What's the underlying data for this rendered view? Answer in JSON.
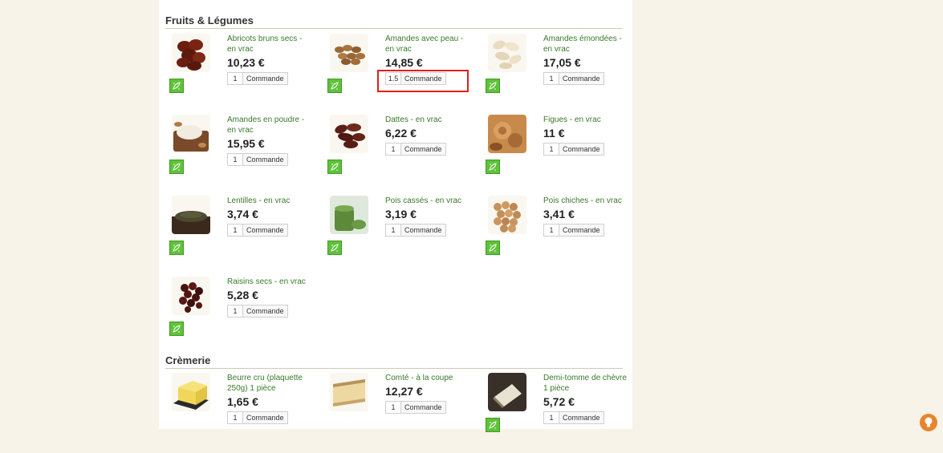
{
  "sections": [
    {
      "title": "Fruits & Légumes",
      "products": [
        {
          "name": "Abricots bruns secs - en vrac",
          "price": "10,23 €",
          "qty": "1",
          "button": "Commande",
          "bio": true
        },
        {
          "name": "Amandes avec peau - en vrac",
          "price": "14,85 €",
          "qty": "1.5",
          "button": "Commande",
          "bio": true
        },
        {
          "name": "Amandes émondées - en vrac",
          "price": "17,05 €",
          "qty": "1",
          "button": "Commande",
          "bio": true
        },
        {
          "name": "Amandes en poudre - en vrac",
          "price": "15,95 €",
          "qty": "1",
          "button": "Commande",
          "bio": true
        },
        {
          "name": "Dattes - en vrac",
          "price": "6,22 €",
          "qty": "1",
          "button": "Commande",
          "bio": true
        },
        {
          "name": "Figues - en vrac",
          "price": "11 €",
          "qty": "1",
          "button": "Commande",
          "bio": true
        },
        {
          "name": "Lentilles - en vrac",
          "price": "3,74 €",
          "qty": "1",
          "button": "Commande",
          "bio": true
        },
        {
          "name": "Pois cassés - en vrac",
          "price": "3,19 €",
          "qty": "1",
          "button": "Commande",
          "bio": true
        },
        {
          "name": "Pois chiches - en vrac",
          "price": "3,41 €",
          "qty": "1",
          "button": "Commande",
          "bio": true
        },
        {
          "name": "Raisins secs - en vrac",
          "price": "5,28 €",
          "qty": "1",
          "button": "Commande",
          "bio": true
        }
      ]
    },
    {
      "title": "Crèmerie",
      "products": [
        {
          "name": "Beurre cru (plaquette 250g) 1 pièce",
          "price": "1,65 €",
          "qty": "1",
          "button": "Commande",
          "bio": false
        },
        {
          "name": "Comté - à la coupe",
          "price": "12,27 €",
          "qty": "1",
          "button": "Commande",
          "bio": false
        },
        {
          "name": "Demi-tomme de chèvre 1 pièce",
          "price": "5,72 €",
          "qty": "1",
          "button": "Commande",
          "bio": true
        }
      ]
    }
  ],
  "colors": {
    "background": "#f7f3e8",
    "content": "#ffffff",
    "product_name": "#3a7a2a",
    "bio_badge": "#5fc23a",
    "highlight": "#e0201b",
    "help_button": "#e8842c"
  },
  "icons": {
    "bio_badge": "bio-leaf-icon",
    "help_button": "lightbulb-icon"
  }
}
